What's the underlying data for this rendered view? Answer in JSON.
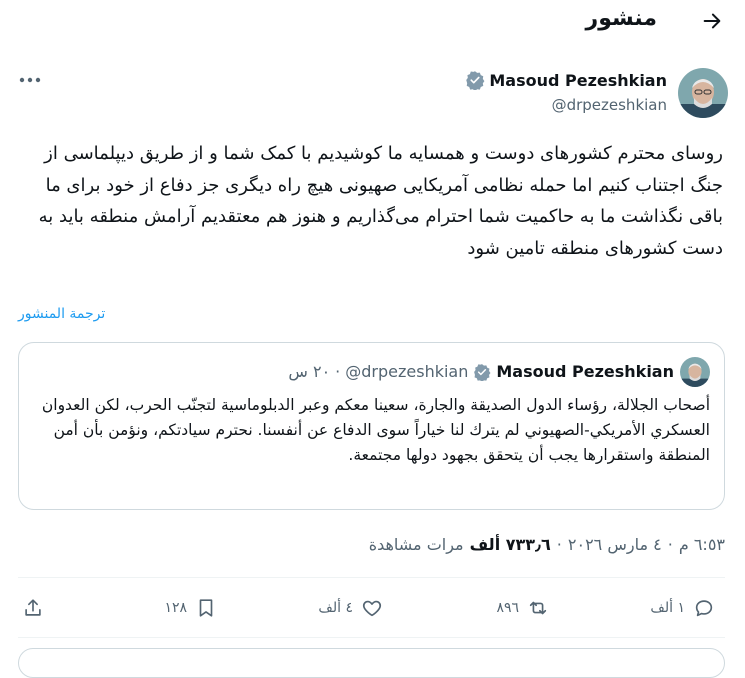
{
  "header": {
    "title": "منشور"
  },
  "author": {
    "name": "Masoud Pezeshkian",
    "handle": "@drpezeshkian"
  },
  "post": {
    "text": "روسای محترم کشورهای دوست و همسایه ما کوشیدیم با کمک شما و از طریق دیپلماسی از جنگ اجتناب کنیم اما حمله نظامی آمریکایی صهیونی هیچ راه دیگری جز دفاع از خود برای ما باقی نگذاشت ما به حاکمیت شما احترام می‌گذاریم و هنوز هم معتقدیم آرامش منطقه باید به دست کشورهای منطقه تامین شود",
    "translate_label": "ترجمة المنشور"
  },
  "quote": {
    "name": "Masoud Pezeshkian",
    "handle": "@drpezeshkian",
    "separator": "·",
    "time": "٢٠ س",
    "text": "أصحاب الجلالة، رؤساء الدول الصديقة والجارة، سعينا معكم وعبر الدبلوماسية لتجنّب الحرب، لكن العدوان العسكري الأمريكي-الصهيوني لم يترك لنا خياراً سوى الدفاع عن أنفسنا. نحترم سيادتكم، ونؤمن بأن أمن المنطقة واستقرارها يجب أن يتحقق بجهود دولها مجتمعة."
  },
  "meta": {
    "time": "٦:٥٣ م",
    "separator": "·",
    "date": "٤ مارس ٢٠٢٦",
    "views_count": "٧٣٣٫٦ ألف",
    "views_label": "مرات مشاهدة"
  },
  "actions": {
    "replies": "١ ألف",
    "reposts": "٨٩٦",
    "likes": "٤ ألف",
    "bookmarks": "١٢٨"
  },
  "colors": {
    "accent": "#1d9bf0",
    "text": "#0f1419",
    "muted": "#536471",
    "border": "#cfd9de",
    "verified": "#829aab"
  },
  "icons": [
    "back-arrow-icon",
    "more-icon",
    "verified-badge-icon",
    "reply-icon",
    "repost-icon",
    "like-icon",
    "bookmark-icon",
    "share-icon"
  ]
}
